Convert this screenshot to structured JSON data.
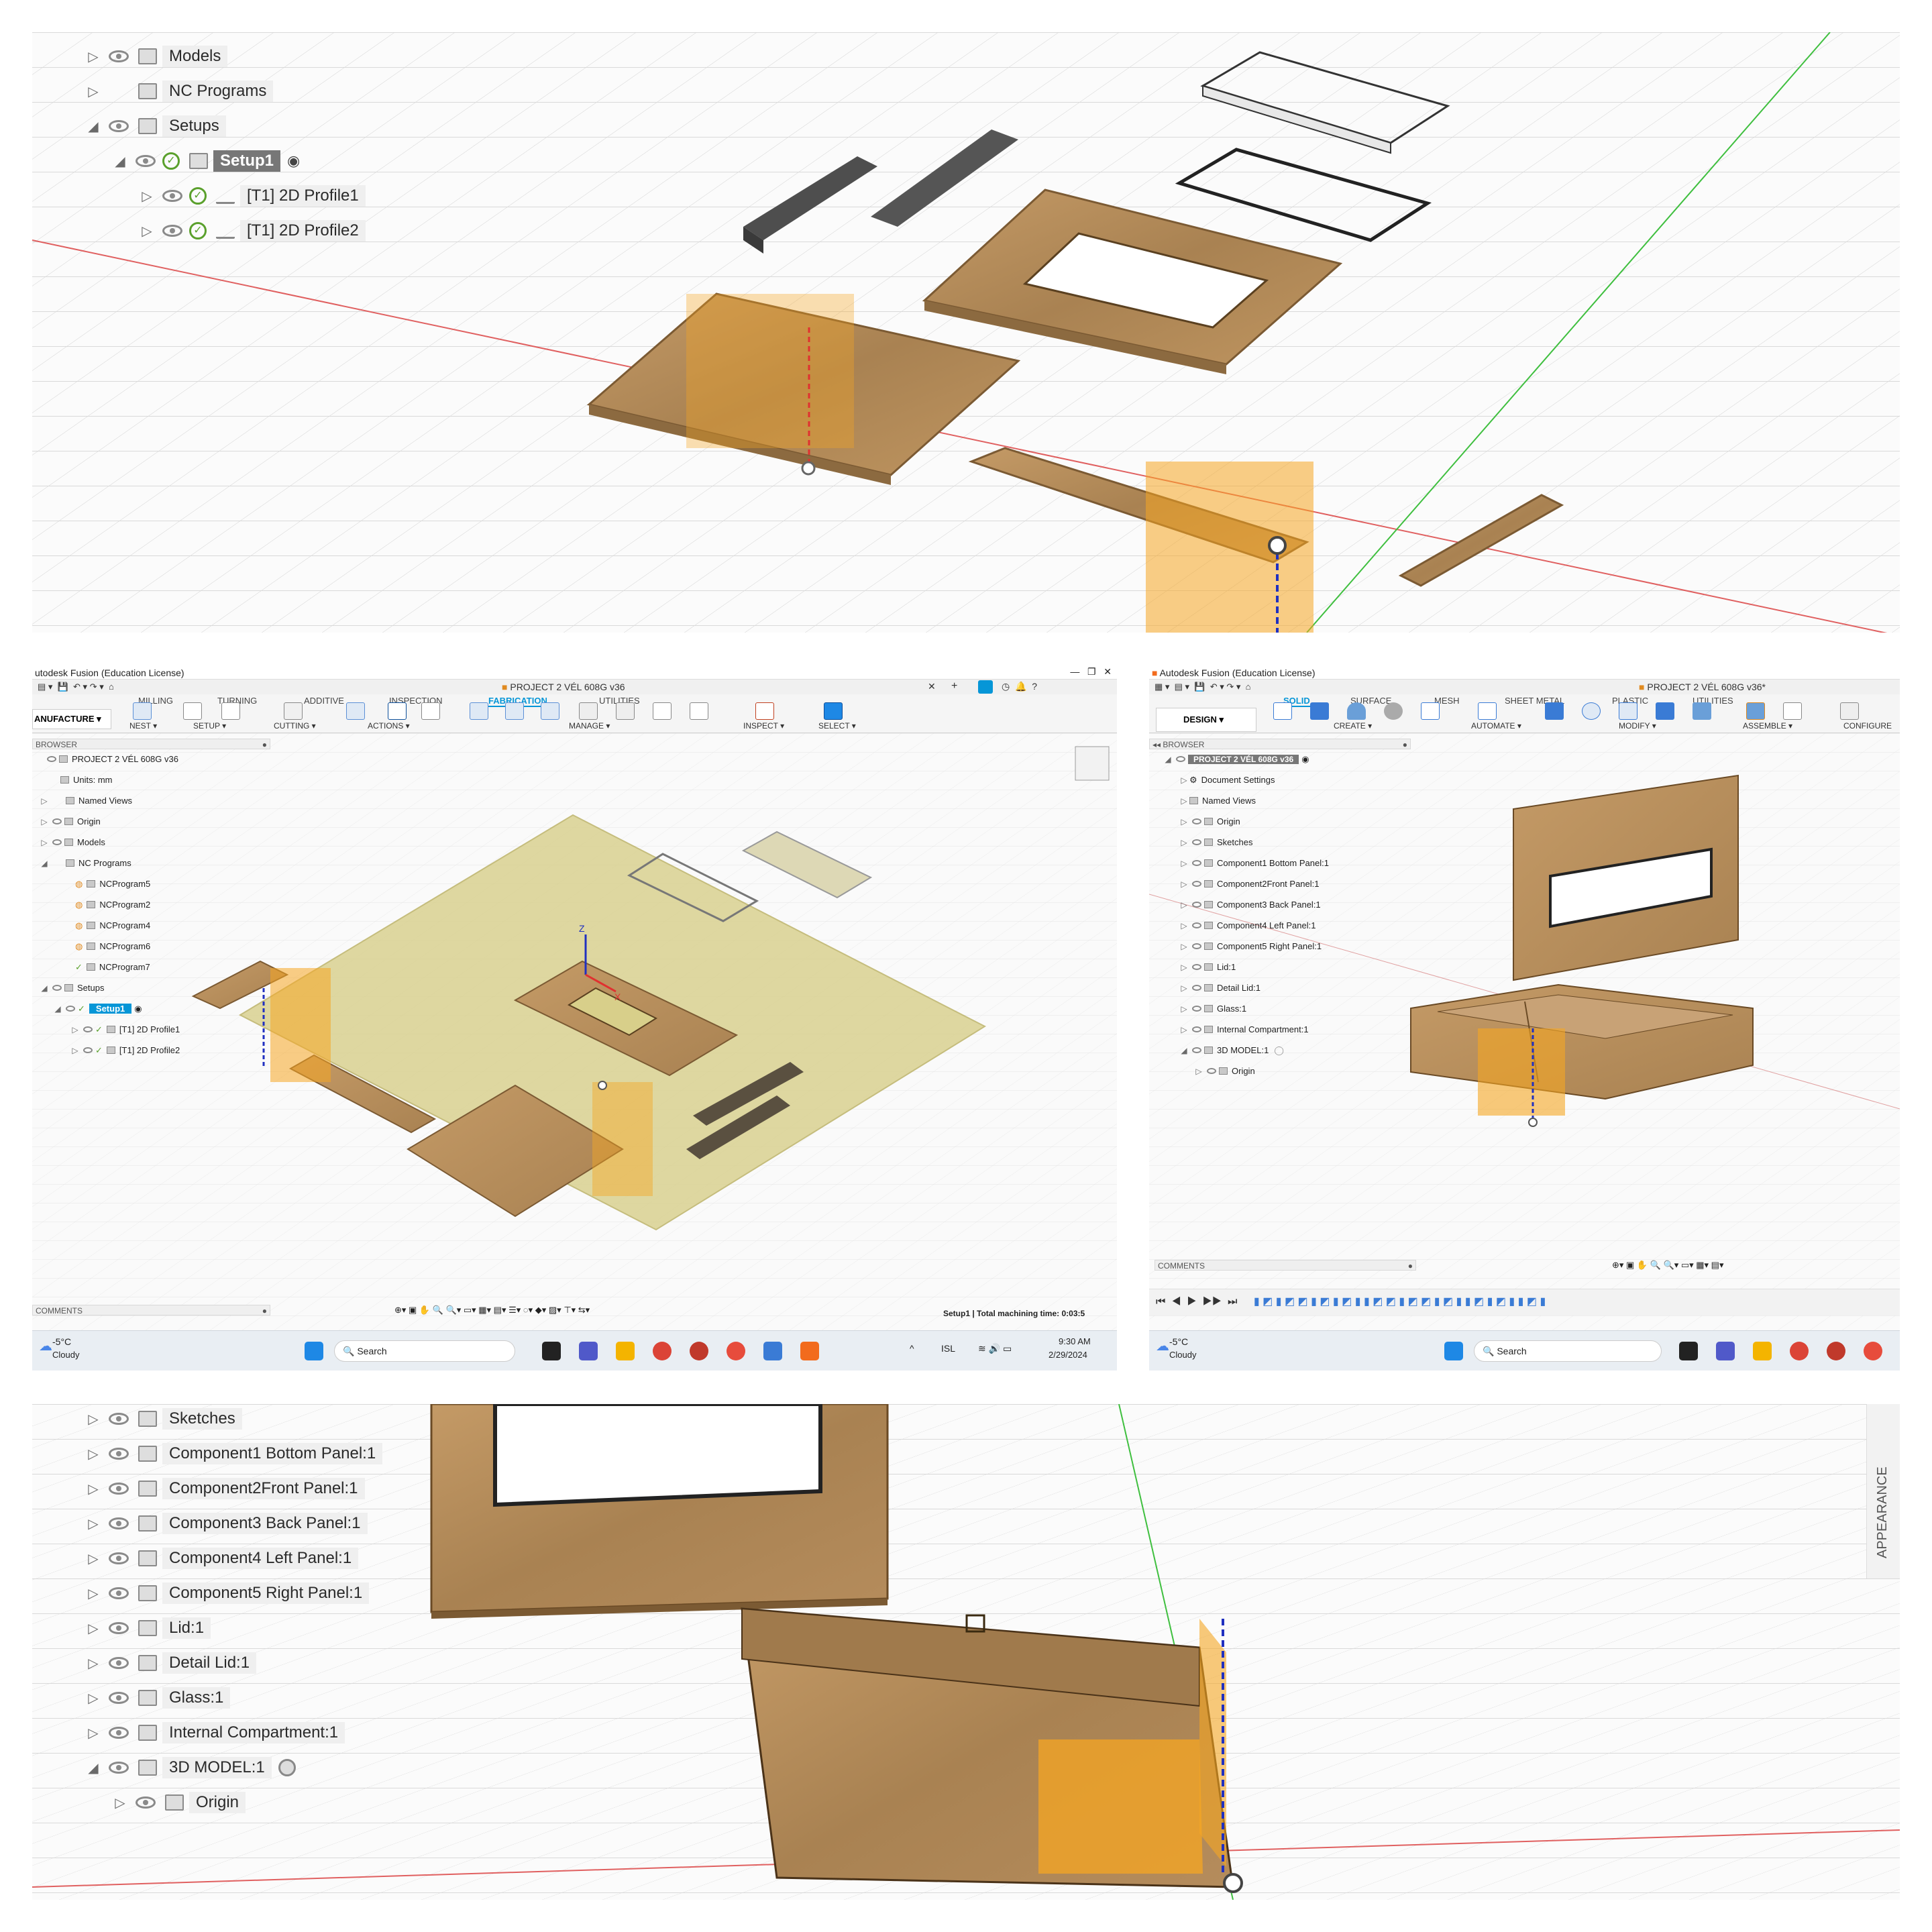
{
  "top_panel": {
    "tree": [
      {
        "label": "Models",
        "expanded": false
      },
      {
        "label": "NC Programs",
        "expanded": false
      },
      {
        "label": "Setups",
        "expanded": true
      },
      {
        "label": "Setup1",
        "expanded": true
      },
      {
        "label": "[T1] 2D Profile1",
        "expanded": false
      },
      {
        "label": "[T1] 2D Profile2",
        "expanded": false
      }
    ]
  },
  "left_window": {
    "title": "utodesk Fusion (Education License)",
    "doc_tab": "PROJECT 2 VÉL 608G v36",
    "ribbon_tabs": [
      "MILLING",
      "TURNING",
      "ADDITIVE",
      "INSPECTION",
      "FABRICATION",
      "UTILITIES"
    ],
    "active_tab": "FABRICATION",
    "workspace": "ANUFACTURE ▾",
    "groups": [
      "NEST ▾",
      "SETUP ▾",
      "CUTTING ▾",
      "ACTIONS ▾",
      "MANAGE ▾",
      "INSPECT ▾",
      "SELECT ▾"
    ],
    "browser_label": "BROWSER",
    "browser": [
      "PROJECT 2 VÉL 608G v36",
      "Units: mm",
      "Named Views",
      "Origin",
      "Models",
      "NC Programs",
      "NCProgram5",
      "NCProgram2",
      "NCProgram4",
      "NCProgram6",
      "NCProgram7",
      "Setups",
      "Setup1",
      "[T1] 2D Profile1",
      "[T1] 2D Profile2"
    ],
    "comments_label": "COMMENTS",
    "status": "Setup1 | Total machining time: 0:03:5",
    "weather_temp": "-5°C",
    "weather_desc": "Cloudy",
    "search_label": "Search",
    "lang": "ISL",
    "time": "9:30 AM",
    "date": "2/29/2024"
  },
  "right_window": {
    "title": "Autodesk Fusion (Education License)",
    "doc_tab": "PROJECT 2 VÉL 608G v36*",
    "ribbon_tabs": [
      "SOLID",
      "SURFACE",
      "MESH",
      "SHEET METAL",
      "PLASTIC",
      "UTILITIES"
    ],
    "active_tab": "SOLID",
    "workspace": "DESIGN ▾",
    "groups": [
      "CREATE ▾",
      "AUTOMATE ▾",
      "MODIFY ▾",
      "ASSEMBLE ▾",
      "CONFIGURE"
    ],
    "browser_label": "BROWSER",
    "browser": [
      "PROJECT 2 VÉL 608G v36",
      "Document Settings",
      "Named Views",
      "Origin",
      "Sketches",
      "Component1 Bottom Panel:1",
      "Component2Front Panel:1",
      "Component3 Back Panel:1",
      "Component4 Left Panel:1",
      "Component5 Right Panel:1",
      "Lid:1",
      "Detail Lid:1",
      "Glass:1",
      "Internal Compartment:1",
      "3D MODEL:1",
      "Origin"
    ],
    "comments_label": "COMMENTS",
    "weather_temp": "-5°C",
    "weather_desc": "Cloudy",
    "search_label": "Search"
  },
  "bottom_panel": {
    "tree": [
      "Sketches",
      "Component1 Bottom Panel:1",
      "Component2Front Panel:1",
      "Component3 Back Panel:1",
      "Component4 Left Panel:1",
      "Component5 Right Panel:1",
      "Lid:1",
      "Detail Lid:1",
      "Glass:1",
      "Internal Compartment:1",
      "3D MODEL:1",
      "Origin"
    ],
    "appearance_label": "APPEARANCE"
  },
  "colors": {
    "wood": "#b38b5c",
    "wood_dark": "#8c6a40",
    "slate": "#4e4e4e",
    "accent_orange": "#f5a623",
    "fusion_blue": "#0696d7"
  }
}
